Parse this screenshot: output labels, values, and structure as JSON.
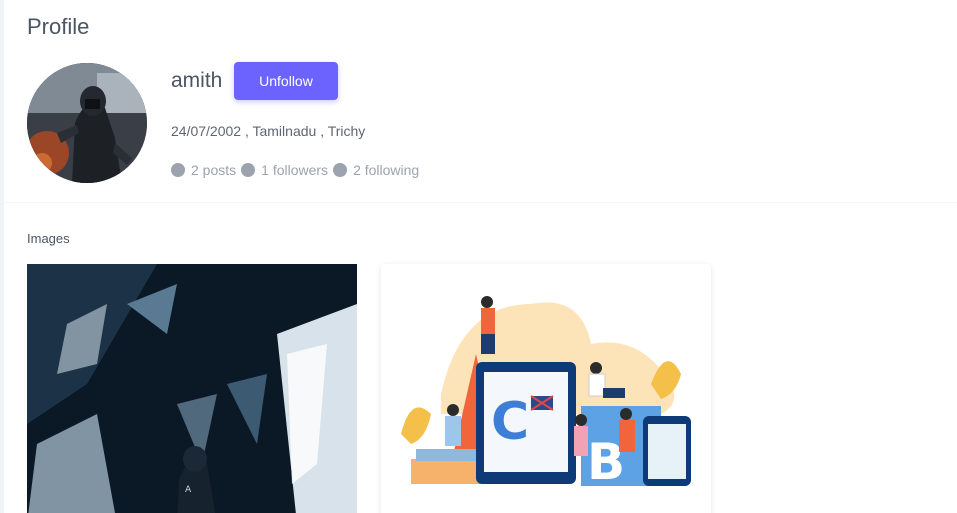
{
  "header": {
    "title": "Profile"
  },
  "user": {
    "name": "amith",
    "details": "24/07/2002 , Tamilnadu , Trichy",
    "follow_button_label": "Unfollow"
  },
  "stats": [
    {
      "label": "2 posts"
    },
    {
      "label": "1 followers"
    },
    {
      "label": "2 following"
    }
  ],
  "images_section": {
    "label": "Images"
  },
  "colors": {
    "accent": "#6c63ff",
    "muted": "#9ca3af",
    "text": "#4b5563"
  }
}
